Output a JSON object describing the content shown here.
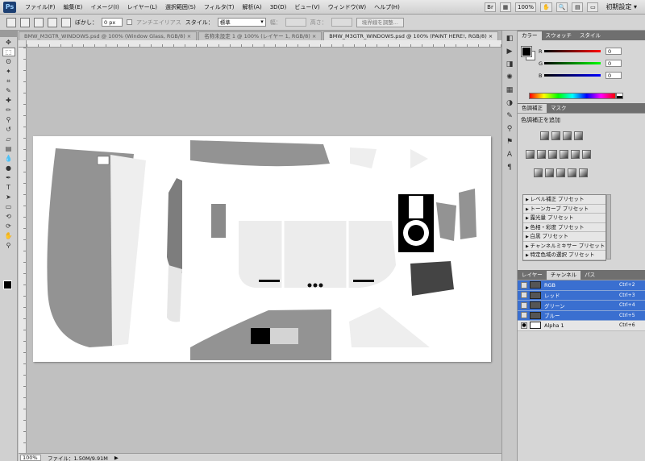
{
  "app": {
    "logo": "Ps"
  },
  "menu": [
    "ファイル(F)",
    "編集(E)",
    "イメージ(I)",
    "レイヤー(L)",
    "選択範囲(S)",
    "フィルタ(T)",
    "解析(A)",
    "3D(D)",
    "ビュー(V)",
    "ウィンドウ(W)",
    "ヘルプ(H)"
  ],
  "menubar_right": {
    "zoom": "100%",
    "workspace": "初期設定 ▾"
  },
  "options": {
    "feather_label": "ぼかし：",
    "feather_value": "0 px",
    "antialias_label": "アンチエイリアス",
    "style_label": "スタイル：",
    "style_value": "標準",
    "width_label": "幅：",
    "height_label": "高さ：",
    "refine_button": "境界線を調整..."
  },
  "tabs": [
    {
      "label": "BMW_M3GTR_WINDOWS.psd @ 100% (Window Glass, RGB/8) ×",
      "active": false
    },
    {
      "label": "名称未設定 1 @ 100% (レイヤー 1, RGB/8) ×",
      "active": false
    },
    {
      "label": "BMW_M3GTR_WINDOWS.psd @ 100% (PAINT HERE!, RGB/8) ×",
      "active": true
    }
  ],
  "status": {
    "zoom": "100%",
    "file_info": "ファイル：1.50M/9.91M"
  },
  "color_panel": {
    "tabs": [
      "カラー",
      "スウォッチ",
      "スタイル"
    ],
    "channels": [
      {
        "label": "R",
        "value": "0",
        "color": "#cc0000"
      },
      {
        "label": "G",
        "value": "0",
        "color": "#00aa00"
      },
      {
        "label": "B",
        "value": "0",
        "color": "#0000cc"
      }
    ]
  },
  "adjust_panel": {
    "tabs": [
      "色調補正",
      "マスク"
    ],
    "title": "色調補正を追加",
    "presets": [
      "レベル補正 プリセット",
      "トーンカーブ プリセット",
      "露光量 プリセット",
      "色相・彩度 プリセット",
      "白黒 プリセット",
      "チャンネルミキサー プリセット",
      "特定色域の選択 プリセット"
    ]
  },
  "layers_panel": {
    "tabs": [
      "レイヤー",
      "チャンネル",
      "パス"
    ],
    "channels": [
      {
        "name": "RGB",
        "shortcut": "Ctrl+2",
        "selected": true
      },
      {
        "name": "レッド",
        "shortcut": "Ctrl+3",
        "selected": true
      },
      {
        "name": "グリーン",
        "shortcut": "Ctrl+4",
        "selected": true
      },
      {
        "name": "ブルー",
        "shortcut": "Ctrl+5",
        "selected": true
      },
      {
        "name": "Alpha 1",
        "shortcut": "Ctrl+6",
        "selected": false
      }
    ]
  }
}
